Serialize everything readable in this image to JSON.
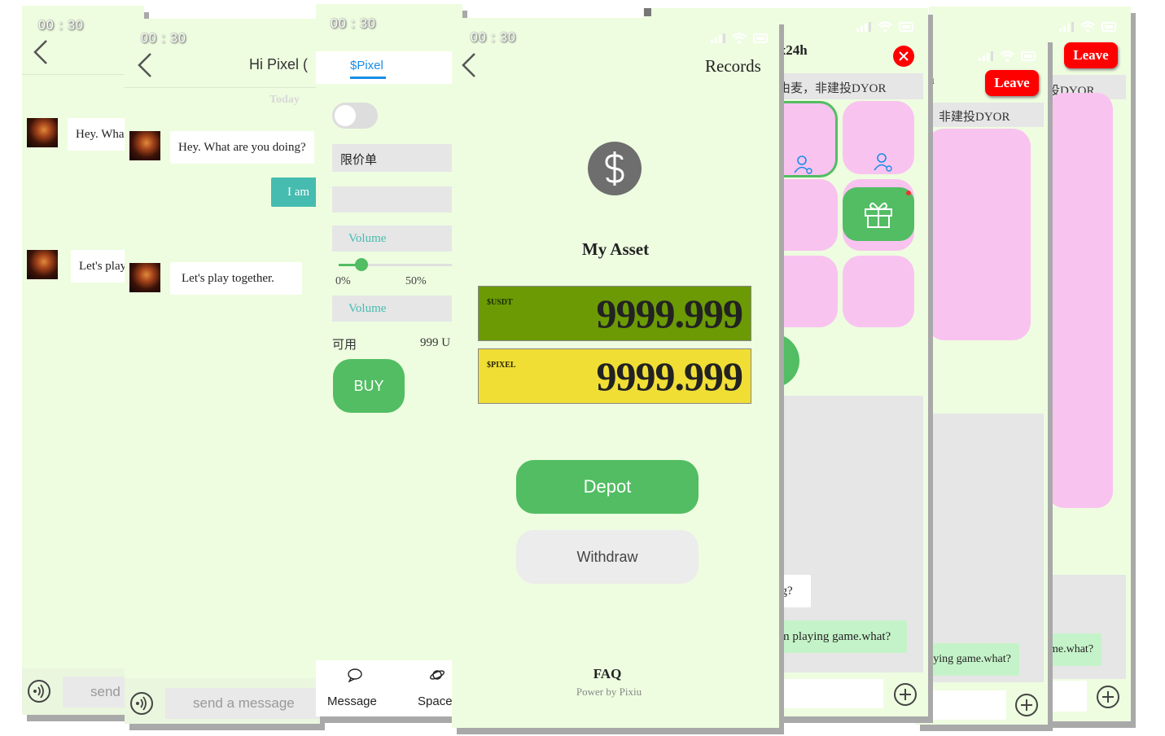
{
  "time": "00 : 30",
  "chat": {
    "header_title": "Hi Pixel (",
    "date_label": "Today",
    "messages": [
      "Hey. What are you doing?",
      "I am ",
      "Let's play together."
    ],
    "messages_short": [
      "Hey. Wha",
      "Let's play"
    ],
    "input_placeholder": "send a message",
    "input_placeholder_short": "send"
  },
  "trade": {
    "token_tab": "$Pixel",
    "order_type": "限价单",
    "volume_placeholder": "Volume",
    "slider_min": "0%",
    "slider_mid": "50%",
    "slider_value": 0.2,
    "available_label": "可用",
    "available_value": "999 U",
    "buy_label": "BUY",
    "nav": [
      "Message",
      "Space"
    ]
  },
  "asset": {
    "records_label": "Records",
    "title": "My Asset",
    "balances": [
      {
        "label": "$USDT",
        "value": "9999.999",
        "color": "#6b9a04"
      },
      {
        "label": "$PIXEL",
        "value": "9999.999",
        "color": "#f0de35"
      }
    ],
    "depot_label": "Depot",
    "withdraw_label": "Withdraw",
    "faq_label": "FAQ",
    "powered_by": "Power by Pixiu"
  },
  "room": {
    "title": "/x24h",
    "title_short": "h",
    "notice": "由麦，非建投DYOR",
    "notice_b": "，非建投DYOR",
    "notice_c": "投DYOR",
    "leave_label": "Leave",
    "msg_partial": "ng?",
    "msg_reply": "m playing game.what?",
    "msg_reply_b": "aying game.what?",
    "msg_reply_c": "me.what?"
  },
  "colors": {
    "accent": "#52bd63",
    "bg": "#eefde0",
    "pink": "#f9c3f0",
    "teal": "#46bcb0",
    "red": "#ff0000",
    "blue": "#1a8de6"
  }
}
